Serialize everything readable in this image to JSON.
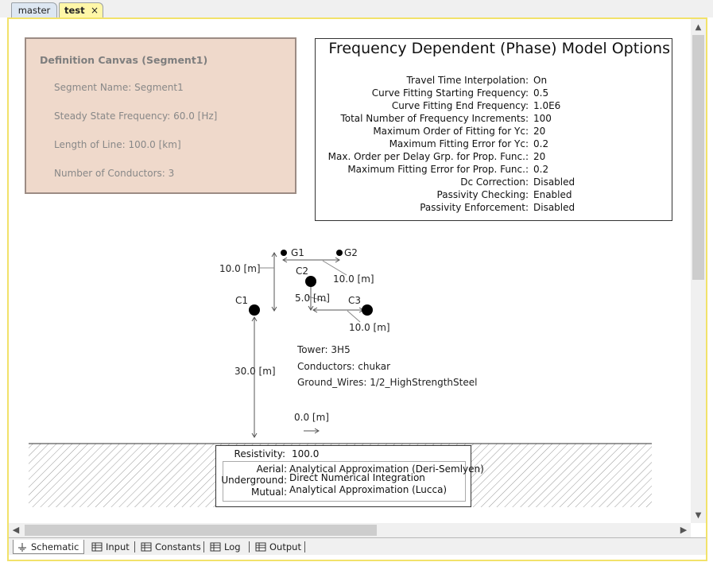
{
  "doc_tabs": {
    "master": "master",
    "test": "test",
    "close": "×"
  },
  "definition": {
    "title": "Definition Canvas (Segment1)",
    "lines": [
      "Segment Name: Segment1",
      "Steady State Frequency: 60.0 [Hz]",
      "Length of Line: 100.0 [km]",
      "Number of Conductors: 3"
    ]
  },
  "options": {
    "title": "Frequency Dependent (Phase) Model Options",
    "rows": [
      {
        "label": "Travel Time Interpolation:",
        "value": "On"
      },
      {
        "label": "Curve Fitting Starting Frequency:",
        "value": "0.5"
      },
      {
        "label": "Curve Fitting End Frequency:",
        "value": "1.0E6"
      },
      {
        "label": "Total Number of Frequency Increments:",
        "value": "100"
      },
      {
        "label": "Maximum Order of Fitting for Yc:",
        "value": "20"
      },
      {
        "label": "Maximum Fitting Error for Yc:",
        "value": "0.2"
      },
      {
        "label": "Max. Order per Delay Grp. for Prop. Func.:",
        "value": "20"
      },
      {
        "label": "Maximum Fitting Error for Prop. Func.:",
        "value": "0.2"
      },
      {
        "label": "Dc Correction:",
        "value": "Disabled"
      },
      {
        "label": "Passivity Checking:",
        "value": "Enabled"
      },
      {
        "label": "Passivity Enforcement:",
        "value": "Disabled"
      }
    ]
  },
  "diagram": {
    "g1": "G1",
    "g2": "G2",
    "c1": "C1",
    "c2": "C2",
    "c3": "C3",
    "dim_g_height": "10.0 [m]",
    "dim_g_spacing": "10.0 [m]",
    "dim_c2_height": "5.0 [m]",
    "dim_c3_spacing": "10.0 [m]",
    "dim_c1_height": "30.0 [m]",
    "dim_offset": "0.0 [m]",
    "tower": "Tower: 3H5",
    "conductors": "Conductors: chukar",
    "ground_wires": "Ground_Wires: 1/2_HighStrengthSteel"
  },
  "ground": {
    "resistivity_label": "Resistivity:",
    "resistivity_value": "100.0",
    "aerial_label": "Aerial:",
    "aerial_value": "Analytical Approximation (Deri-Semlyen)",
    "underground_label": "Underground:",
    "underground_value": "Direct Numerical Integration",
    "mutual_label": "Mutual:",
    "mutual_value": "Analytical Approximation (Lucca)"
  },
  "bottom_tabs": [
    "Schematic",
    "Input",
    "Constants",
    "Log",
    "Output"
  ],
  "colors": {
    "active_tab": "#fff7a8",
    "frame_border": "#f2e26a",
    "definition_bg": "#efd9cb"
  }
}
